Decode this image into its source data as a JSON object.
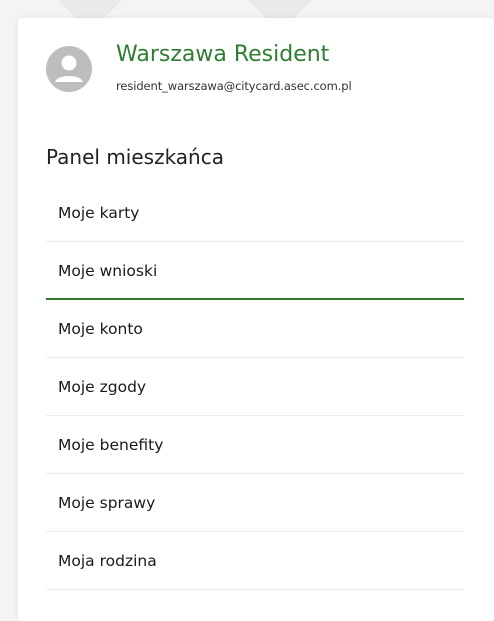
{
  "profile": {
    "name": "Warszawa Resident",
    "email": "resident_warszawa@citycard.asec.com.pl",
    "avatar_icon": "user-avatar-icon"
  },
  "panel": {
    "title": "Panel mieszkańca",
    "items": [
      {
        "label": "Moje karty",
        "active": false
      },
      {
        "label": "Moje wnioski",
        "active": true
      },
      {
        "label": "Moje konto",
        "active": false
      },
      {
        "label": "Moje zgody",
        "active": false
      },
      {
        "label": "Moje benefity",
        "active": false
      },
      {
        "label": "Moje sprawy",
        "active": false
      },
      {
        "label": "Moja rodzina",
        "active": false
      }
    ]
  },
  "colors": {
    "accent": "#2e7d32",
    "avatar_bg": "#bdbdbd",
    "divider": "#ececec"
  }
}
